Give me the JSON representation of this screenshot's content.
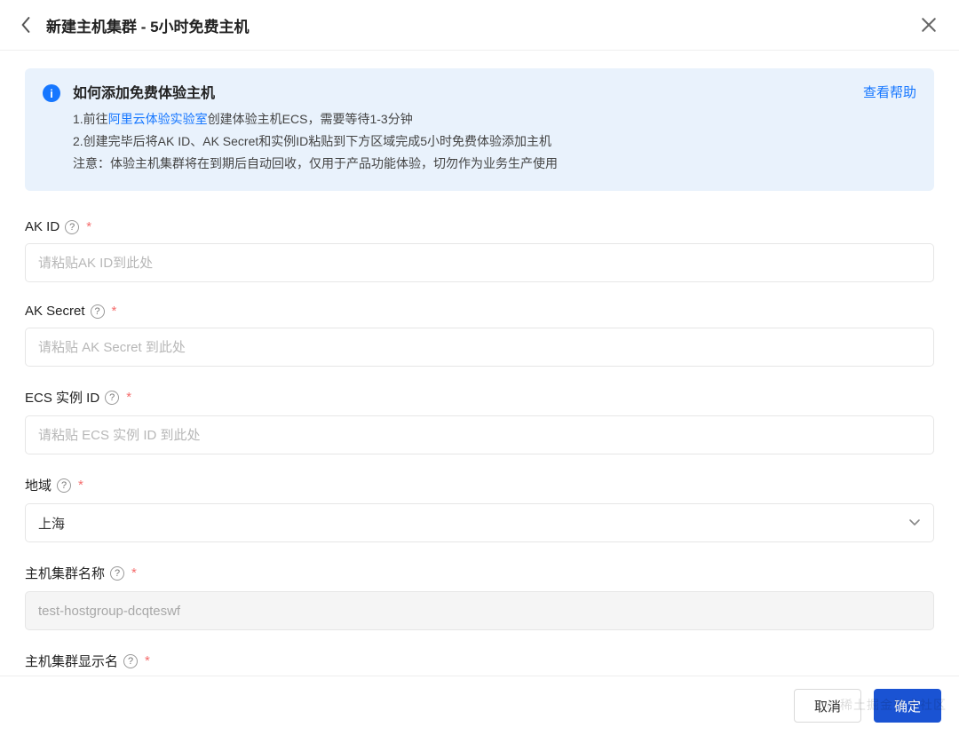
{
  "header": {
    "title": "新建主机集群 - 5小时免费主机"
  },
  "info": {
    "title": "如何添加免费体验主机",
    "help_link": "查看帮助",
    "line1_prefix": "1.前往",
    "line1_link": "阿里云体验实验室",
    "line1_suffix": "创建体验主机ECS，需要等待1-3分钟",
    "line2": "2.创建完毕后将AK ID、AK Secret和实例ID粘贴到下方区域完成5小时免费体验添加主机",
    "line3": "注意：体验主机集群将在到期后自动回收，仅用于产品功能体验，切勿作为业务生产使用"
  },
  "form": {
    "ak_id": {
      "label": "AK ID",
      "placeholder": "请粘贴AK ID到此处",
      "value": ""
    },
    "ak_secret": {
      "label": "AK Secret",
      "placeholder": "请粘贴 AK Secret 到此处",
      "value": ""
    },
    "ecs_id": {
      "label": "ECS 实例 ID",
      "placeholder": "请粘贴 ECS 实例 ID 到此处",
      "value": ""
    },
    "region": {
      "label": "地域",
      "value": "上海"
    },
    "cluster_name": {
      "label": "主机集群名称",
      "value": "test-hostgroup-dcqteswf"
    },
    "display_name": {
      "label": "主机集群显示名"
    }
  },
  "footer": {
    "cancel": "取消",
    "confirm": "确定"
  },
  "watermark": "@稀土掘金技术社区"
}
